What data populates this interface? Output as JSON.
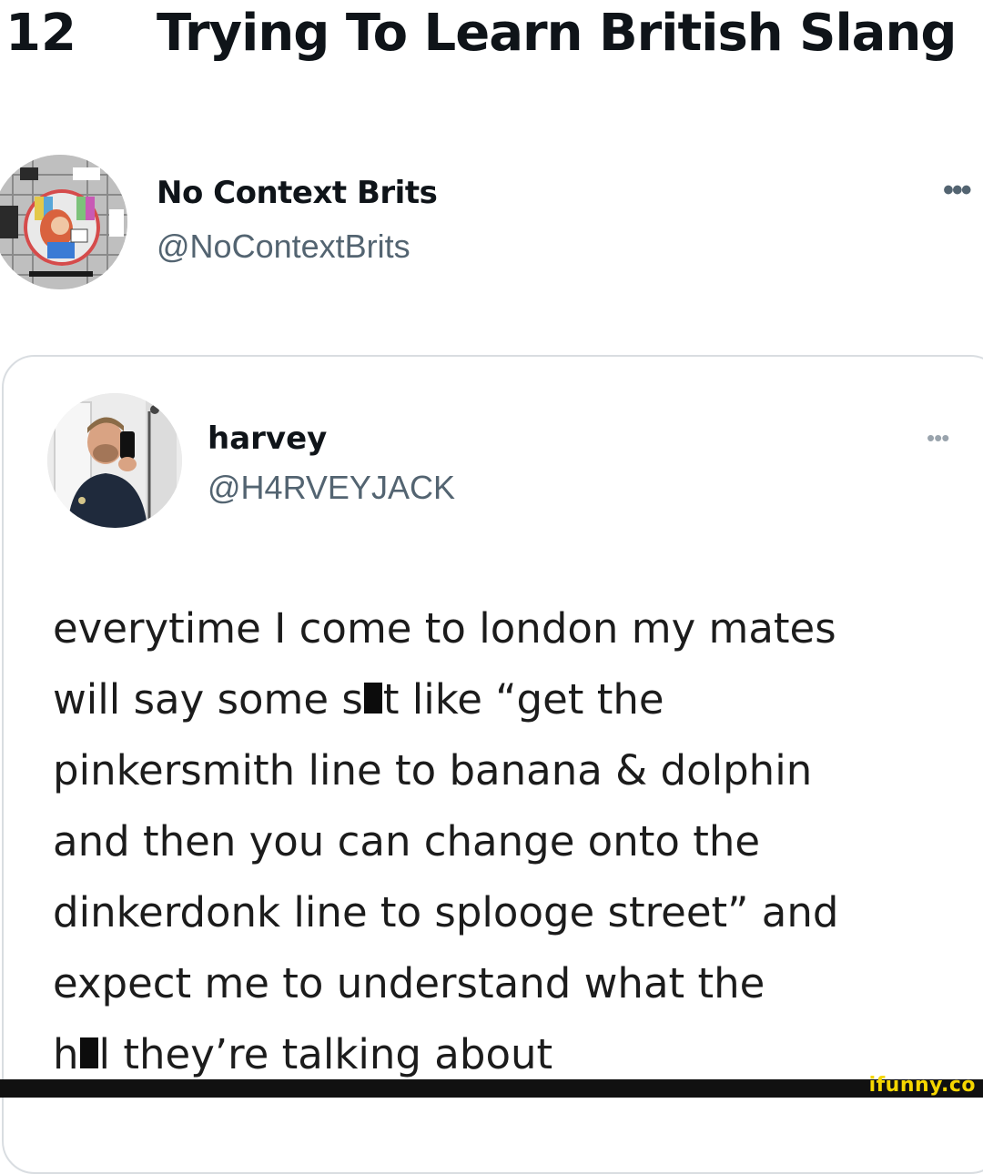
{
  "header": {
    "number": "12",
    "title": "Trying To Learn British Slang"
  },
  "tweet": {
    "author_name": "No Context Brits",
    "author_handle": "@NoContextBrits",
    "more_icon": "more-horizontal-icon",
    "more_glyph": "•••"
  },
  "quoted_tweet": {
    "author_name": "harvey",
    "author_handle": "@H4RVEYJACK",
    "more_glyph": "•••",
    "body_lines": [
      {
        "before": "everytime I come to london my mates",
        "after": ""
      },
      {
        "before": "will say some s",
        "after": "t like “get the"
      },
      {
        "before": "pinkersmith line to banana & dolphin",
        "after": ""
      },
      {
        "before": "and then you can change onto the",
        "after": ""
      },
      {
        "before": "dinkerdonk line to splooge street” and",
        "after": ""
      },
      {
        "before": "expect me to understand what the",
        "after": ""
      },
      {
        "before": "h",
        "after": "l they’re talking about"
      }
    ]
  },
  "watermark": {
    "text": "ifunny.co",
    "color": "#f5d600"
  },
  "colors": {
    "text": "#0f1419",
    "secondary": "#536471",
    "border": "#d9dde1"
  }
}
